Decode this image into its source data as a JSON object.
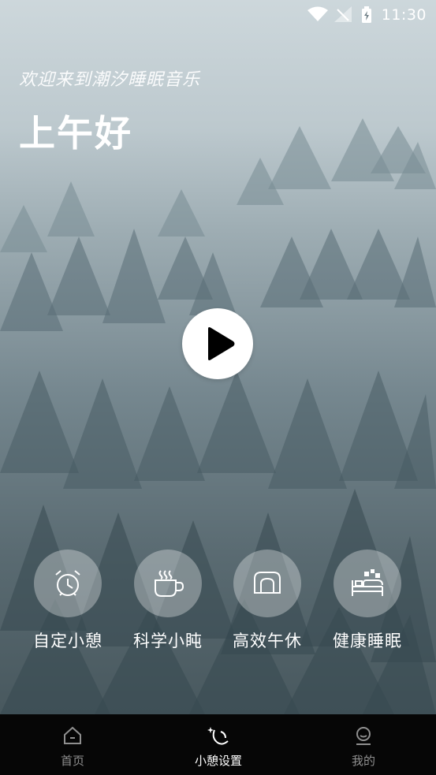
{
  "status_bar": {
    "time": "11:30"
  },
  "header": {
    "welcome": "欢迎来到潮汐睡眠音乐",
    "greeting": "上午好"
  },
  "features": [
    {
      "label": "自定小憩",
      "icon": "alarm-clock-icon"
    },
    {
      "label": "科学小盹",
      "icon": "coffee-cup-icon"
    },
    {
      "label": "高效午休",
      "icon": "arch-icon"
    },
    {
      "label": "健康睡眠",
      "icon": "bed-icon"
    }
  ],
  "tabbar": {
    "items": [
      {
        "label": "首页",
        "icon": "home-icon",
        "active": false
      },
      {
        "label": "小憩设置",
        "icon": "moon-star-icon",
        "active": true
      },
      {
        "label": "我的",
        "icon": "profile-icon",
        "active": false
      }
    ]
  },
  "colors": {
    "tabbar_bg": "#060606",
    "tab_inactive": "#8f8f8f",
    "tab_active": "#ffffff"
  }
}
